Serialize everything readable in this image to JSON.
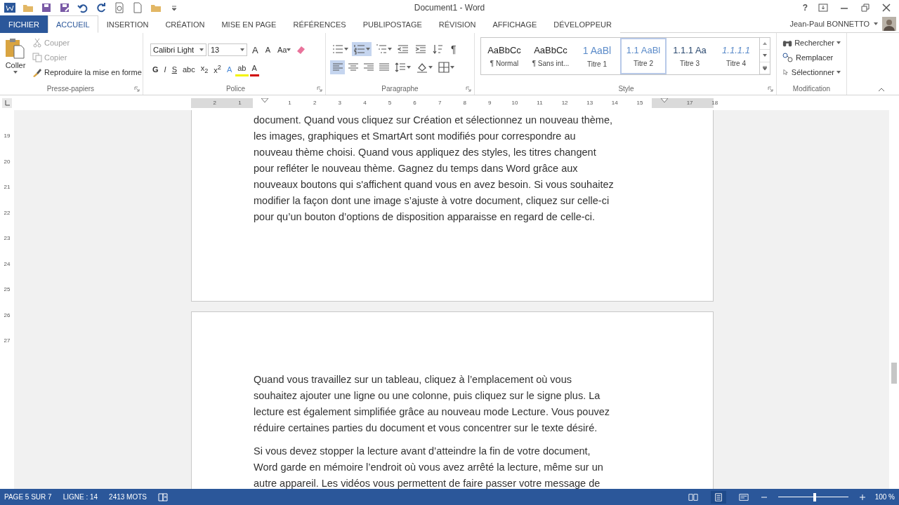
{
  "title_bar": {
    "title": "Document1 - Word",
    "help": "?"
  },
  "tabs": [
    {
      "label": "FICHIER",
      "kind": "file",
      "selected": false
    },
    {
      "label": "ACCUEIL",
      "kind": "tab",
      "selected": true
    },
    {
      "label": "INSERTION",
      "kind": "tab",
      "selected": false
    },
    {
      "label": "CRÉATION",
      "kind": "tab",
      "selected": false
    },
    {
      "label": "MISE EN PAGE",
      "kind": "tab",
      "selected": false
    },
    {
      "label": "RÉFÉRENCES",
      "kind": "tab",
      "selected": false
    },
    {
      "label": "PUBLIPOSTAGE",
      "kind": "tab",
      "selected": false
    },
    {
      "label": "RÉVISION",
      "kind": "tab",
      "selected": false
    },
    {
      "label": "AFFICHAGE",
      "kind": "tab",
      "selected": false
    },
    {
      "label": "DÉVELOPPEUR",
      "kind": "tab",
      "selected": false
    }
  ],
  "user": {
    "name": "Jean-Paul BONNETTO"
  },
  "clipboard": {
    "paste": "Coller",
    "actions": [
      {
        "label": "Couper",
        "kind": "cut",
        "disabled": true
      },
      {
        "label": "Copier",
        "kind": "copy",
        "disabled": true
      },
      {
        "label": "Reproduire la mise en forme",
        "kind": "brush",
        "disabled": false
      }
    ],
    "group_label": "Presse-papiers"
  },
  "font": {
    "name": "Calibri Light",
    "size": "13",
    "sizing": [
      {
        "label": "A",
        "kind": "grow"
      },
      {
        "label": "A",
        "kind": "shrink"
      },
      {
        "label": "Aa",
        "kind": "case"
      }
    ],
    "formats": [
      {
        "label": "G",
        "kind": "bold"
      },
      {
        "label": "I",
        "kind": "italic"
      },
      {
        "label": "S",
        "kind": "underline"
      },
      {
        "label": "abc",
        "kind": "strike"
      },
      {
        "label": "x$_{2}$",
        "kind": "plain"
      },
      {
        "label": "x$^{2}$",
        "kind": "plain"
      },
      {
        "label": "A",
        "kind": "effect"
      },
      {
        "label": "ab",
        "kind": "highlight"
      },
      {
        "label": "A",
        "kind": "color"
      }
    ],
    "group_label": "Police"
  },
  "paragraph": {
    "row1": [
      {
        "kind": "bullets",
        "selected": false
      },
      {
        "kind": "numbering",
        "selected": true
      },
      {
        "kind": "multilevel",
        "selected": false
      },
      {
        "kind": "outdent",
        "selected": false
      },
      {
        "kind": "indent",
        "selected": false
      },
      {
        "kind": "sort",
        "selected": false
      }
    ],
    "pilcrow": "¶",
    "row2": [
      {
        "kind": "left",
        "selected": true
      },
      {
        "kind": "center",
        "selected": false
      },
      {
        "kind": "right",
        "selected": false
      },
      {
        "kind": "justify",
        "selected": false
      },
      {
        "kind": "spacing",
        "selected": false
      },
      {
        "kind": "shading",
        "selected": false
      },
      {
        "kind": "borders",
        "selected": false
      }
    ],
    "group_label": "Paragraphe"
  },
  "styles": {
    "items": [
      {
        "preview": "AaBbCc",
        "label": "¶ Normal",
        "kind": "normal",
        "selected": false
      },
      {
        "preview": "AaBbCc",
        "label": "¶ Sans int...",
        "kind": "normal",
        "selected": false
      },
      {
        "preview": "1  AaBl",
        "label": "Titre 1",
        "kind": "h1",
        "selected": false
      },
      {
        "preview": "1.1  AaBl",
        "label": "Titre 2",
        "kind": "h2",
        "selected": true
      },
      {
        "preview": "1.1.1  Aa",
        "label": "Titre 3",
        "kind": "h3",
        "selected": false
      },
      {
        "preview": "1.1.1.1",
        "label": "Titre 4",
        "kind": "h4",
        "selected": false
      }
    ],
    "group_label": "Style"
  },
  "editing": {
    "items": [
      {
        "label": "Rechercher",
        "kind": "find",
        "dropdown": true
      },
      {
        "label": "Remplacer",
        "kind": "replace",
        "dropdown": false
      },
      {
        "label": "Sélectionner",
        "kind": "select",
        "dropdown": true
      }
    ],
    "group_label": "Modification"
  },
  "ruler": [
    {
      "kind": "number",
      "label": "2"
    },
    {
      "kind": "number",
      "label": "1"
    },
    {
      "kind": "indent"
    },
    {
      "kind": "number",
      "label": "1"
    },
    {
      "kind": "number",
      "label": "2"
    },
    {
      "kind": "number",
      "label": "3"
    },
    {
      "kind": "number",
      "label": "4"
    },
    {
      "kind": "number",
      "label": "5"
    },
    {
      "kind": "number",
      "label": "6"
    },
    {
      "kind": "number",
      "label": "7"
    },
    {
      "kind": "number",
      "label": "8"
    },
    {
      "kind": "number",
      "label": "9"
    },
    {
      "kind": "number",
      "label": "10"
    },
    {
      "kind": "number",
      "label": "11"
    },
    {
      "kind": "number",
      "label": "12"
    },
    {
      "kind": "number",
      "label": "13"
    },
    {
      "kind": "number",
      "label": "14"
    },
    {
      "kind": "number",
      "label": "15"
    },
    {
      "kind": "indent"
    },
    {
      "kind": "number",
      "label": "17"
    },
    {
      "kind": "number",
      "label": "18"
    }
  ],
  "vertical_ruler": [
    "19",
    "20",
    "21",
    "22",
    "23",
    "24",
    "25",
    "26",
    "27"
  ],
  "pages": [
    {
      "paragraphs": [
        [
          "document. Quand vous cliquez sur Création et sélectionnez un nouveau thème,",
          "les images, graphiques et SmartArt sont modifiés pour correspondre au",
          "nouveau thème choisi. Quand vous appliquez des styles, les titres changent",
          "pour refléter le nouveau thème. Gagnez du temps dans Word grâce aux",
          "nouveaux boutons qui s'affichent quand vous en avez besoin. Si vous souhaitez",
          "modifier la façon dont une image s’ajuste à votre document, cliquez sur celle-ci",
          "pour qu’un bouton d’options de disposition apparaisse en regard de celle-ci."
        ]
      ]
    },
    {
      "paragraphs": [
        [
          "Quand vous travaillez sur un tableau, cliquez à l’emplacement où vous",
          "souhaitez ajouter une ligne ou une colonne, puis cliquez sur le signe plus. La",
          "lecture est également simplifiée grâce au nouveau mode Lecture. Vous pouvez",
          "réduire certaines parties du document et vous concentrer sur le texte désiré."
        ],
        [
          "Si vous devez stopper la lecture avant d’atteindre la fin de votre document,",
          "Word garde en mémoire l’endroit où vous avez arrêté la lecture, même sur un",
          "autre appareil. Les vidéos vous permettent de faire passer votre message de"
        ]
      ]
    }
  ],
  "status_bar": {
    "items": [
      "PAGE 5 SUR 7",
      "LIGNE : 14",
      "2413 MOTS"
    ],
    "views": [
      {
        "kind": "read",
        "selected": false
      },
      {
        "kind": "print",
        "selected": true
      },
      {
        "kind": "web",
        "selected": false
      }
    ],
    "zoom": {
      "level": 0.5,
      "reading": "100 %"
    }
  }
}
